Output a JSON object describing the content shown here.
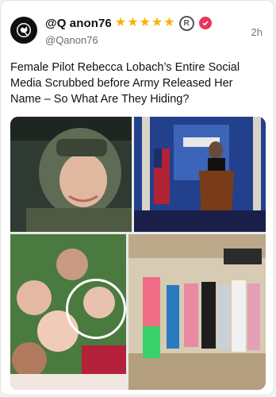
{
  "post": {
    "display_name": "@Q anon76",
    "handle": "@Qanon76",
    "timestamp": "2h",
    "text": "Female Pilot Rebecca Lobach’s Entire Social Media Scrubbed before Army Released Her Name – So What Are They Hiding?",
    "stars": [
      "star-icon",
      "star-icon",
      "star-icon",
      "star-icon",
      "star-icon"
    ],
    "registered_mark": "R",
    "colors": {
      "star": "#f5b400",
      "verified": "#e8365d",
      "handle": "#6b6b6b"
    }
  },
  "media": {
    "photos": [
      {
        "name": "pilot-helmet-photo"
      },
      {
        "name": "press-briefing-podium-photo"
      },
      {
        "name": "group-selfie-photo"
      },
      {
        "name": "group-station-photo"
      }
    ]
  }
}
